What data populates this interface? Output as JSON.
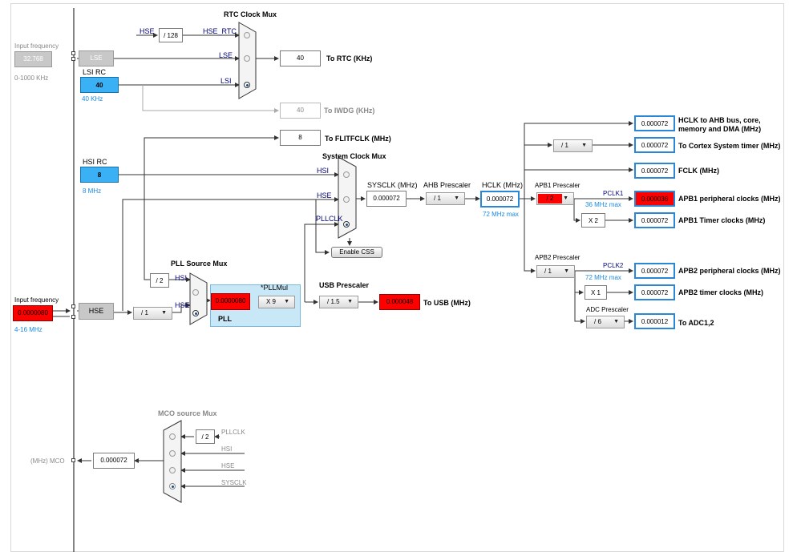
{
  "rtc_mux": {
    "title": "RTC Clock Mux",
    "hse_label": "HSE",
    "div_value": "/ 128",
    "hse_rtc_label": "HSE_RTC",
    "lse_label": "LSE",
    "lsi_label": "LSI",
    "to_rtc_value": "40",
    "to_rtc_label": "To RTC (KHz)",
    "to_iwdg_value": "40",
    "to_iwdg_label": "To IWDG (KHz)"
  },
  "lse": {
    "input_label": "Input frequency",
    "input_value": "32.768",
    "range": "0-1000 KHz",
    "block_label": "LSE"
  },
  "lsi": {
    "title": "LSI RC",
    "value": "40",
    "unit": "40 KHz"
  },
  "flitf": {
    "value": "8",
    "label": "To FLITFCLK (MHz)"
  },
  "hsi": {
    "title": "HSI RC",
    "value": "8",
    "unit": "8 MHz"
  },
  "sys_mux": {
    "title": "System Clock Mux",
    "hsi_label": "HSI",
    "hse_label": "HSE",
    "pllclk_label": "PLLCLK",
    "enable_css": "Enable CSS"
  },
  "sysclk": {
    "title": "SYSCLK (MHz)",
    "value": "0.000072"
  },
  "ahb": {
    "title": "AHB Prescaler",
    "value": "/ 1"
  },
  "hclk": {
    "title": "HCLK (MHz)",
    "value": "0.000072",
    "max": "72 MHz max"
  },
  "outputs": {
    "hclk_ahb_value": "0.000072",
    "hclk_ahb_label_1": "HCLK to AHB bus, core,",
    "hclk_ahb_label_2": "memory and DMA (MHz)",
    "cortex_div": "/ 1",
    "cortex_value": "0.000072",
    "cortex_label": "To Cortex System timer (MHz)",
    "fclk_value": "0.000072",
    "fclk_label": "FCLK (MHz)"
  },
  "apb1": {
    "title": "APB1 Prescaler",
    "value": "/ 2",
    "pclk_label": "PCLK1",
    "max": "36 MHz max",
    "periph_value": "0.000036",
    "periph_label": "APB1 peripheral clocks (MHz)",
    "timer_mul": "X 2",
    "timer_value": "0.000072",
    "timer_label": "APB1 Timer clocks (MHz)"
  },
  "apb2": {
    "title": "APB2 Prescaler",
    "value": "/ 1",
    "pclk_label": "PCLK2",
    "max": "72 MHz max",
    "periph_value": "0.000072",
    "periph_label": "APB2 peripheral clocks (MHz)",
    "timer_mul": "X 1",
    "timer_value": "0.000072",
    "timer_label": "APB2 timer clocks (MHz)",
    "adc_title": "ADC Prescaler",
    "adc_value": "/ 6",
    "adc_out": "0.000012",
    "adc_label": "To ADC1,2"
  },
  "hse": {
    "input_label": "Input frequency",
    "input_value": "0.0000080",
    "range": "4-16 MHz",
    "block_label": "HSE",
    "prediv_value": "/ 1"
  },
  "pll": {
    "src_title": "PLL Source Mux",
    "hsi_div": "/ 2",
    "hsi_label": "HSI",
    "hse_label": "HSE",
    "pll_value": "0.0000080",
    "mul_title": "*PLLMul",
    "mul_value": "X 9",
    "label": "PLL"
  },
  "usb": {
    "title": "USB Prescaler",
    "value": "/ 1.5",
    "out": "0.000048",
    "label": "To USB (MHz)"
  },
  "mco": {
    "title": "MCO source Mux",
    "div": "/ 2",
    "pllclk_label": "PLLCLK",
    "hsi_label": "HSI",
    "hse_label": "HSE",
    "sysclk_label": "SYSCLK",
    "out_label": "(MHz) MCO",
    "out_value": "0.000072"
  },
  "colors": {
    "selected_blue": "#3ab0f5",
    "error_red": "#ff0000",
    "output_border": "#2a86d8",
    "pll_bg": "#c8e8f8"
  }
}
